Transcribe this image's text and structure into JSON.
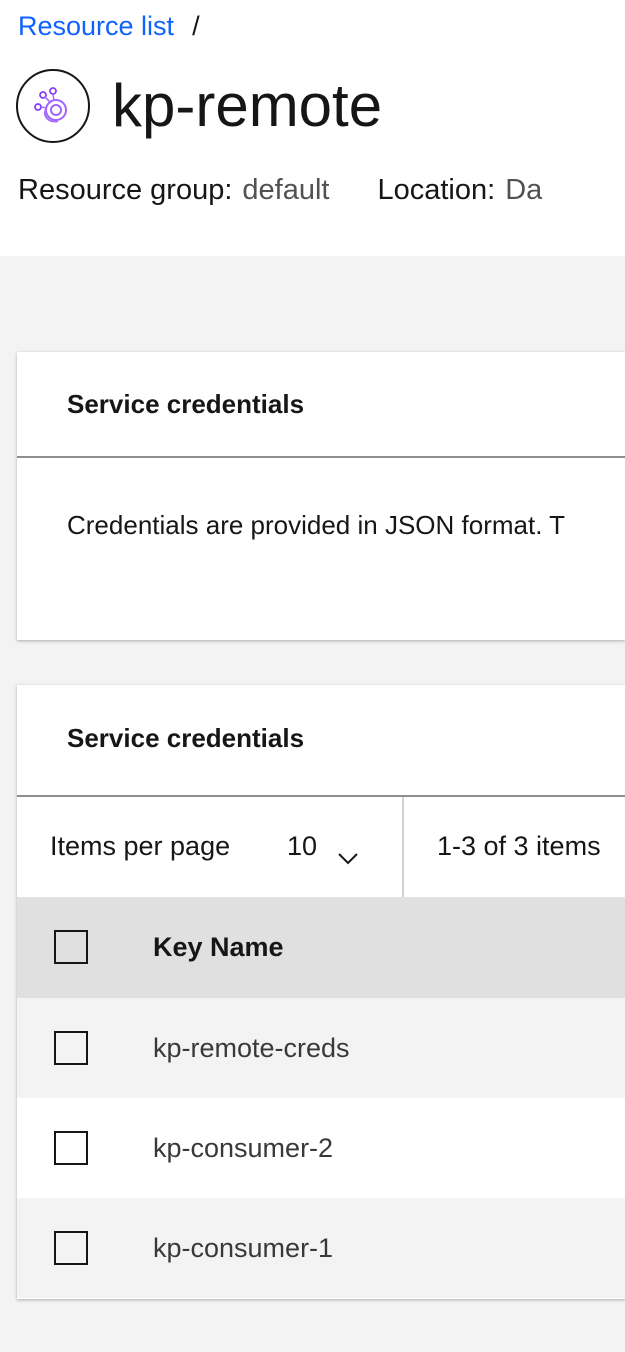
{
  "breadcrumb": {
    "link_label": "Resource list",
    "separator": "/"
  },
  "header": {
    "title": "kp-remote",
    "icon": "event-streams-service-icon",
    "resource_group_label": "Resource group:",
    "resource_group_value": "default",
    "location_label": "Location:",
    "location_value": "Da"
  },
  "info_card": {
    "title": "Service credentials",
    "description": "Credentials are provided in JSON format. T"
  },
  "credentials_table": {
    "title": "Service credentials",
    "pagination": {
      "items_per_page_label": "Items per page",
      "items_per_page_value": "10",
      "range_text": "1-3 of 3 items"
    },
    "columns": [
      "Key Name"
    ],
    "rows": [
      {
        "key_name": "kp-remote-creds"
      },
      {
        "key_name": "kp-consumer-2"
      },
      {
        "key_name": "kp-consumer-1"
      }
    ]
  },
  "colors": {
    "link": "#0f62fe",
    "text_primary": "#161616",
    "page_background": "#f3f3f3",
    "table_header_bg": "#e0e0e0"
  }
}
